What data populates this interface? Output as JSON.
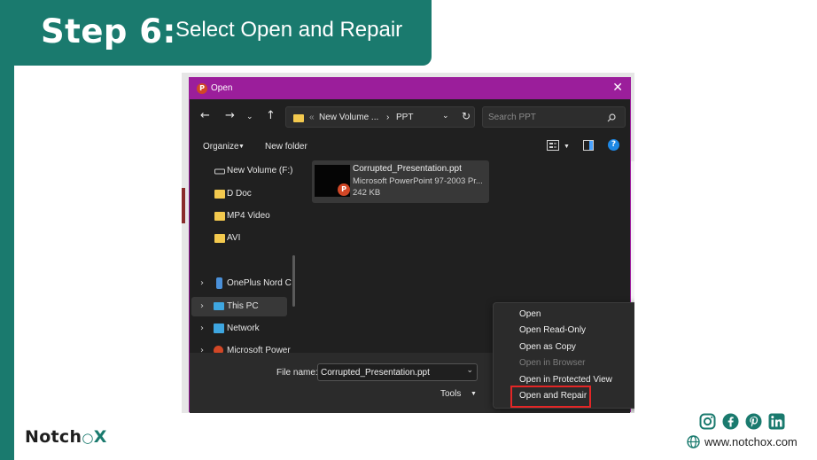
{
  "slide": {
    "step_label": "Step 6:",
    "step_title": "Select Open and Repair",
    "brand_left": "Notch",
    "brand_right": "X",
    "website": "www.notchox.com",
    "social_icons": [
      "instagram-icon",
      "facebook-icon",
      "pinterest-icon",
      "linkedin-icon"
    ],
    "accent_color": "#1a7a6e"
  },
  "dialog": {
    "title": "Open",
    "title_bar_color": "#9b1e9b",
    "breadcrumb": [
      "«",
      "New Volume ...",
      "›",
      "PPT"
    ],
    "search_placeholder": "Search PPT",
    "organize_label": "Organize",
    "new_folder_label": "New folder"
  },
  "sidebar": {
    "items": [
      {
        "label": "New Volume (F:)",
        "icon": "drive-icon"
      },
      {
        "label": "D Doc",
        "icon": "folder-icon"
      },
      {
        "label": "MP4 Video",
        "icon": "folder-icon"
      },
      {
        "label": "AVI",
        "icon": "folder-icon"
      },
      {
        "label": "OnePlus Nord C",
        "icon": "phone-icon"
      },
      {
        "label": "This PC",
        "icon": "pc-icon",
        "selected": true
      },
      {
        "label": "Network",
        "icon": "network-icon"
      },
      {
        "label": "Microsoft Power",
        "icon": "powerpoint-icon"
      }
    ]
  },
  "file": {
    "name": "Corrupted_Presentation.ppt",
    "type": "Microsoft PowerPoint 97-2003 Pr...",
    "size": "242 KB"
  },
  "bottom": {
    "file_name_label": "File name:",
    "file_name_value": "Corrupted_Presentation.ppt",
    "tools_label": "Tools"
  },
  "open_menu": {
    "items": [
      {
        "label": "Open",
        "disabled": false
      },
      {
        "label": "Open Read-Only",
        "disabled": false
      },
      {
        "label": "Open as Copy",
        "disabled": false
      },
      {
        "label": "Open in Browser",
        "disabled": true
      },
      {
        "label": "Open in Protected View",
        "disabled": false
      },
      {
        "label": "Open and Repair",
        "disabled": false,
        "highlighted": true
      }
    ]
  }
}
